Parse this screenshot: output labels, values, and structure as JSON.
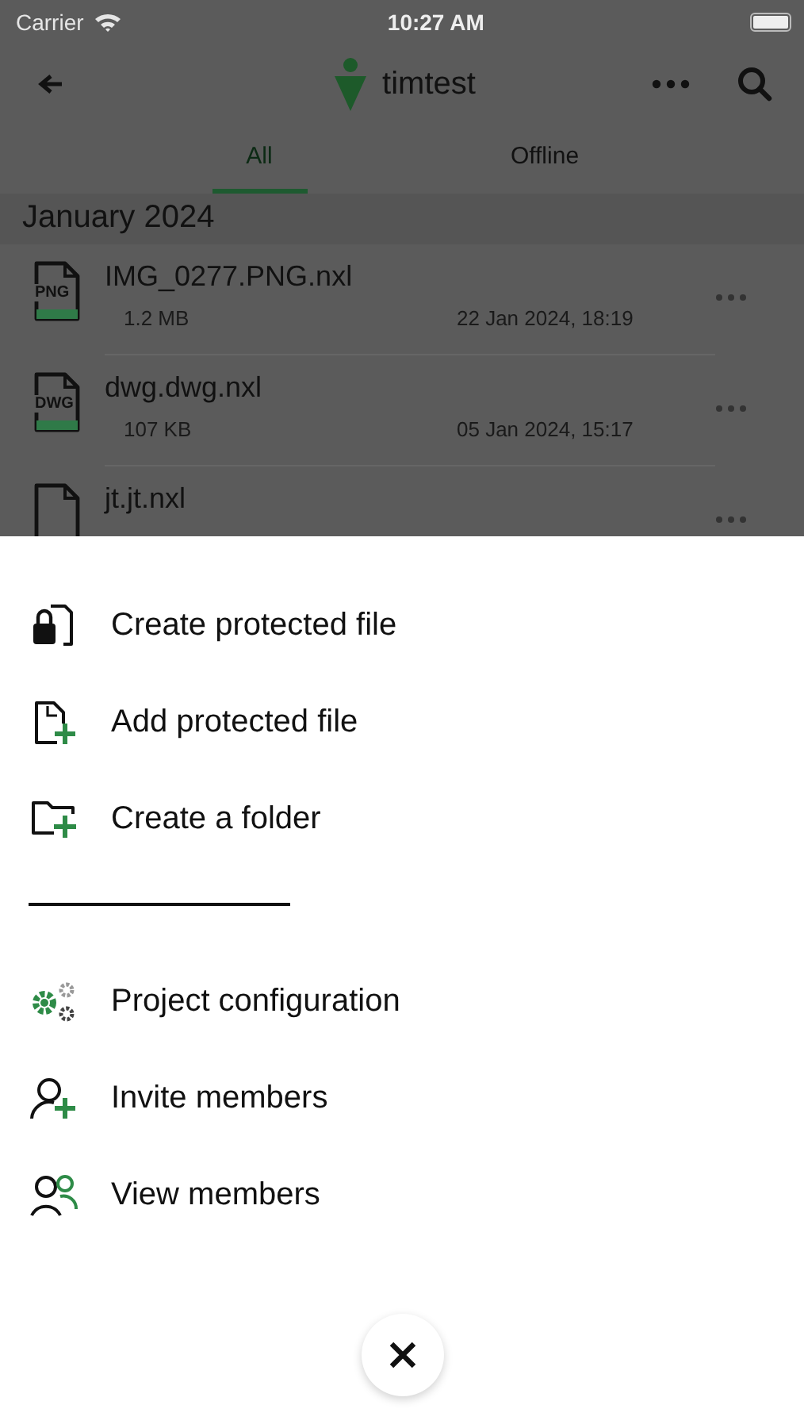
{
  "status_bar": {
    "carrier": "Carrier",
    "time": "10:27 AM"
  },
  "header": {
    "title": "timtest"
  },
  "tabs": [
    {
      "label": "All",
      "selected": true
    },
    {
      "label": "Offline",
      "selected": false
    }
  ],
  "section": "January 2024",
  "files": [
    {
      "name": "IMG_0277.PNG.nxl",
      "icon_label": "PNG",
      "size": "1.2 MB",
      "date": "22 Jan 2024, 18:19"
    },
    {
      "name": "dwg.dwg.nxl",
      "icon_label": "DWG",
      "size": "107 KB",
      "date": "05 Jan 2024, 15:17"
    },
    {
      "name": "jt.jt.nxl"
    }
  ],
  "menu": [
    {
      "kind": "lock-file",
      "label": "Create protected file"
    },
    {
      "kind": "add-file",
      "label": "Add protected file"
    },
    {
      "kind": "add-folder",
      "label": "Create a folder"
    },
    {
      "kind": "divider"
    },
    {
      "kind": "gears",
      "label": "Project configuration"
    },
    {
      "kind": "add-person",
      "label": "Invite members"
    },
    {
      "kind": "people",
      "label": "View members"
    }
  ]
}
